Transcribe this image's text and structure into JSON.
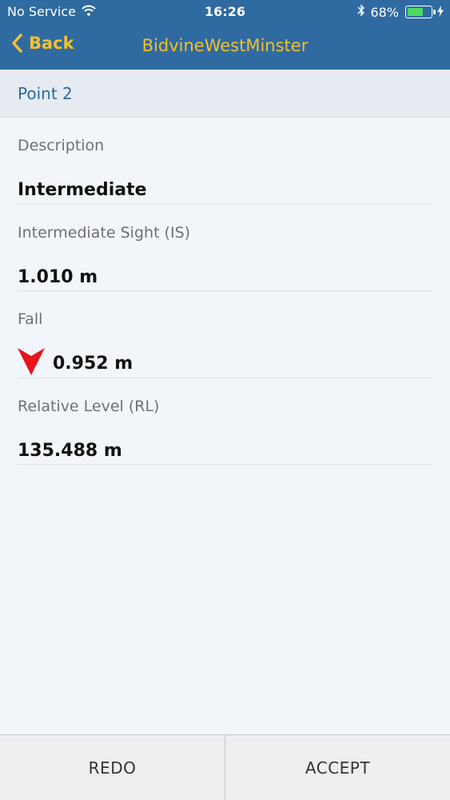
{
  "status_bar": {
    "carrier": "No Service",
    "time": "16:26",
    "battery_percent": "68%",
    "battery_level": 0.68,
    "icons": [
      "wifi-icon",
      "bluetooth-icon",
      "battery-icon",
      "charging-bolt-icon"
    ]
  },
  "nav": {
    "back_label": "Back",
    "back_icon": "chevron-left-icon",
    "title": "BidvineWestMinster"
  },
  "section": {
    "title": "Point 2"
  },
  "fields": {
    "description": {
      "label": "Description",
      "value": "Intermediate"
    },
    "intermediate_sight": {
      "label": "Intermediate Sight (IS)",
      "value": "1.010 m"
    },
    "fall": {
      "label": "Fall",
      "value": "0.952 m",
      "icon": "down-arrow-icon"
    },
    "relative_level": {
      "label": "Relative Level (RL)",
      "value": "135.488 m"
    }
  },
  "toolbar": {
    "redo_label": "REDO",
    "accept_label": "ACCEPT"
  },
  "colors": {
    "header_bg": "#2f6aa0",
    "header_accent": "#f2c12e",
    "section_title": "#2c6aa0",
    "fall_arrow": "#e8141b",
    "battery_fill": "#4cd964"
  }
}
